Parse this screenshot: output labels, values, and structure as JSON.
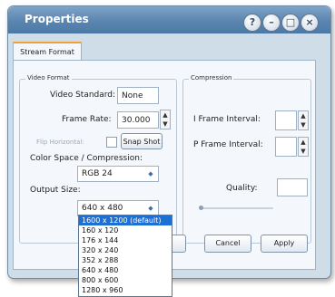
{
  "window": {
    "title": "Properties",
    "help_glyph": "?",
    "minimize_glyph": "–",
    "maximize_glyph": "□",
    "close_glyph": "×"
  },
  "tabs": [
    {
      "label": "Stream Format",
      "active": true
    }
  ],
  "video_format": {
    "group_label": "Video Format",
    "video_standard_label": "Video Standard:",
    "video_standard_value": "None",
    "frame_rate_label": "Frame Rate:",
    "frame_rate_value": "30.000",
    "flip_horizontal_label": "Flip Horizontal:",
    "snap_shot_label": "Snap Shot",
    "color_space_label": "Color Space / Compression:",
    "color_space_value": "RGB 24",
    "output_size_label": "Output Size:",
    "output_size_value": "640 x 480"
  },
  "compression": {
    "group_label": "Compression",
    "i_frame_label": "I Frame Interval:",
    "p_frame_label": "P Frame Interval:",
    "quality_label": "Quality:"
  },
  "buttons": {
    "cancel": "Cancel",
    "apply": "Apply"
  },
  "dropdown_options": [
    "1600 x 1200  (default)",
    "160 x 120",
    "176 x 144",
    "320 x 240",
    "352 x 288",
    "640 x 480",
    "800 x 600",
    "1280 x 960"
  ],
  "spin_up_glyph": "▲",
  "spin_down_glyph": "▼",
  "select_arrow_glyph": "◆",
  "colors": {
    "titlebar": "#5a85b0",
    "tab_accent": "#f0a23a",
    "selection": "#1e6fd4"
  }
}
